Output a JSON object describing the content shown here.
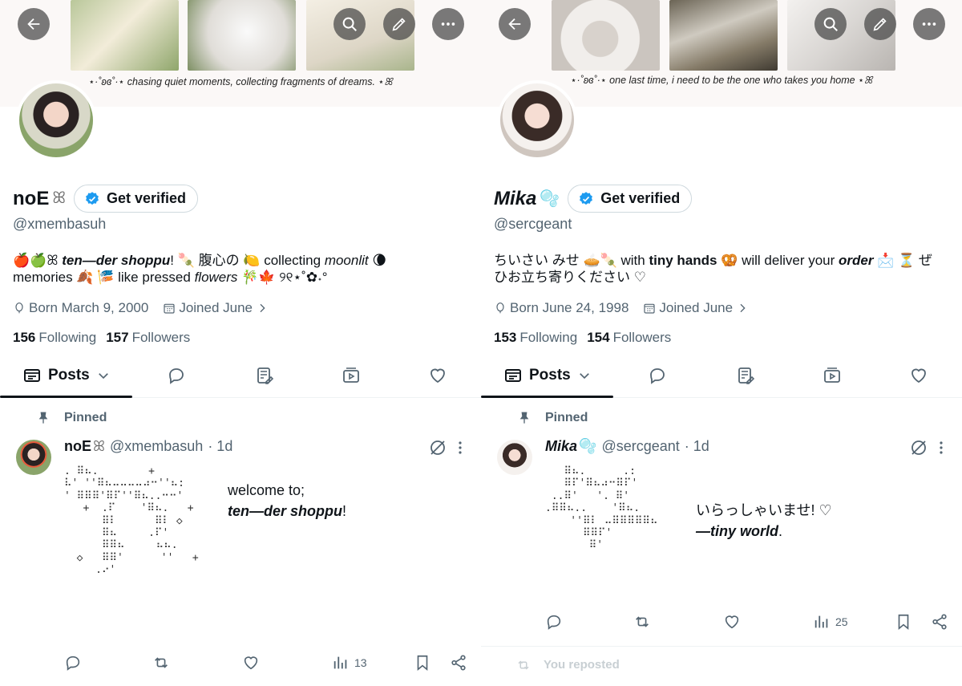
{
  "colors": {
    "accent": "#1d9bf0",
    "muted": "#536471",
    "text": "#0f1419",
    "btn_bg": "#464646"
  },
  "left": {
    "banner_caption": "⋆·˚ʚɞ˚·⋆ chasing quiet moments, collecting fragments of dreams. ⋆ꕤ",
    "display_name": "noE",
    "name_glyph": "ꕤ",
    "verify_label": "Get verified",
    "handle": "@xmembasuh",
    "bio_line1_a": "🍎🍏ꕤ ",
    "bio_line1_b": "ten—der shoppu",
    "bio_line1_c": "! 🍡 腹心の 🍋 collecting ",
    "bio_line1_d": "moonlit",
    "bio_line1_e": " 🌘",
    "bio_line2_a": "memories 🍂 🎏 like pressed ",
    "bio_line2_b": "flowers",
    "bio_line2_c": " 🎋🍁 ୨୧⋆˚✿˖°",
    "birth": "Born March 9, 2000",
    "joined": "Joined June",
    "following_count": "156",
    "following_label": "Following",
    "followers_count": "157",
    "followers_label": "Followers",
    "posts_tab": "Posts",
    "pinned_label": "Pinned",
    "tweet_name": "noE",
    "tweet_name_glyph": "ꕤ",
    "tweet_handle": "@xmembasuh",
    "tweet_time": "· 1d",
    "tweet_line1": "welcome to;",
    "tweet_line2_a": "ten—der shoppu",
    "tweet_line2_b": "!",
    "views": "13",
    "ascii": ". ⠿⠦.        +\n⠧' ''⠿⠦⠤⠤⠤⠤⠴⠒''⠦:\n' ⠿⠿⠿'⠿⠏''⠿⠦..⠒⠒'\n   +  .⠏    '⠿⠦.   +\n      ⠿⠇      ⠿⠇ ◇\n      ⠿⠦     .⠏'\n      ⠿⠿⠦     ⠦⠦.\n  ◇   ⠿⠿'      ''   +\n     .⠔'"
  },
  "right": {
    "banner_caption": "⋆·˚ʚɞ˚·⋆ one last time, i need to be the one who takes you home ⋆ꕤ",
    "display_name": "Mika",
    "name_glyph": "🫧",
    "verify_label": "Get verified",
    "handle": "@sercgeant",
    "bio_line1_a": "ちいさい みせ 🥧🍡 with ",
    "bio_line1_b": "tiny hands",
    "bio_line1_c": " 🥨 will deliver your ",
    "bio_line1_d": "order",
    "bio_line1_e": " 📩 ⏳ ぜ",
    "bio_line2": "ひお立ち寄りください ♡",
    "birth": "Born June 24, 1998",
    "joined": "Joined June",
    "following_count": "153",
    "following_label": "Following",
    "followers_count": "154",
    "followers_label": "Followers",
    "posts_tab": "Posts",
    "pinned_label": "Pinned",
    "tweet_name": "Mika",
    "tweet_name_glyph": "🫧",
    "tweet_handle": "@sercgeant",
    "tweet_time": "· 1d",
    "tweet_line1": "いらっしゃいませ! ♡",
    "tweet_line2_a": "—tiny world",
    "tweet_line2_b": ".",
    "views": "25",
    "reposted": "You reposted",
    "ascii": "   ⠿⠦.      .:\n   ⠿⠏'⠿⠦⠴⠒⠿⠏'\n ..⠿'   '. ⠿'\n.⠿⠿⠦..    '⠿⠦.\n    ''⠿⠇ ⠤⠿⠿⠿⠿⠿⠦\n      ⠿⠿⠏'\n       ⠿'"
  }
}
